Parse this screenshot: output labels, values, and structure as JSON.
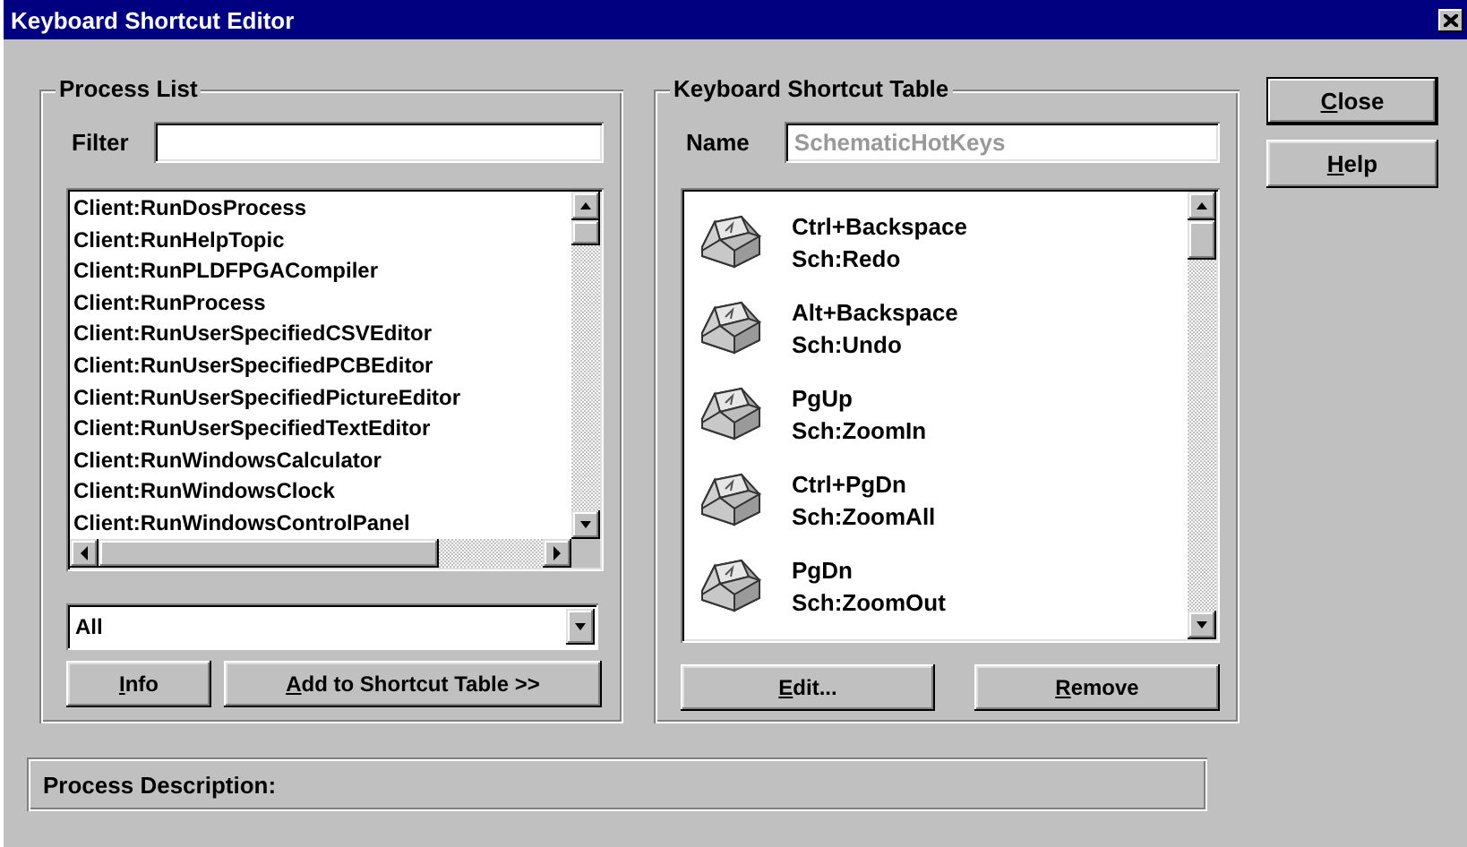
{
  "window": {
    "title": "Keyboard Shortcut Editor"
  },
  "process_list": {
    "title": "Process List",
    "filter": {
      "label": "Filter"
    },
    "items": [
      "Client:RunDosProcess",
      "Client:RunHelpTopic",
      "Client:RunPLDFPGACompiler",
      "Client:RunProcess",
      "Client:RunUserSpecifiedCSVEditor",
      "Client:RunUserSpecifiedPCBEditor",
      "Client:RunUserSpecifiedPictureEditor",
      "Client:RunUserSpecifiedTextEditor",
      "Client:RunWindowsCalculator",
      "Client:RunWindowsClock",
      "Client:RunWindowsControlPanel"
    ],
    "category": {
      "value": "All"
    },
    "buttons": [
      "Info",
      "Add to Shortcut Table >>"
    ]
  },
  "shortcut_table": {
    "title": "Keyboard Shortcut Table",
    "name": {
      "label": "Name",
      "value": "SchematicHotKeys",
      "disabled": true
    },
    "shortcuts": [
      {
        "keys": "Ctrl+Backspace",
        "command": "Sch:Redo"
      },
      {
        "keys": "Alt+Backspace",
        "command": "Sch:Undo"
      },
      {
        "keys": "PgUp",
        "command": "Sch:ZoomIn"
      },
      {
        "keys": "Ctrl+PgDn",
        "command": "Sch:ZoomAll"
      },
      {
        "keys": "PgDn",
        "command": "Sch:ZoomOut"
      }
    ],
    "buttons": [
      "Edit...",
      "Remove"
    ]
  },
  "dialog_buttons": [
    "Close",
    "Help"
  ],
  "process_description": {
    "label": "Process Description:"
  }
}
